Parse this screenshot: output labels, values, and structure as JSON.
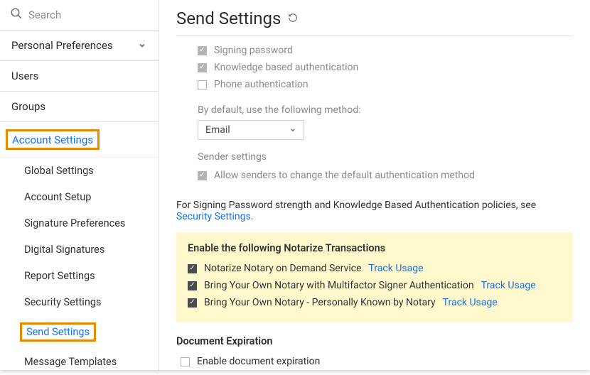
{
  "search": {
    "placeholder": "Search"
  },
  "sidebar": {
    "personal_prefs": "Personal Preferences",
    "users": "Users",
    "groups": "Groups",
    "account_settings": "Account Settings",
    "items": [
      {
        "label": "Global Settings"
      },
      {
        "label": "Account Setup"
      },
      {
        "label": "Signature Preferences"
      },
      {
        "label": "Digital Signatures"
      },
      {
        "label": "Report Settings"
      },
      {
        "label": "Security Settings"
      },
      {
        "label": "Send Settings"
      },
      {
        "label": "Message Templates"
      }
    ]
  },
  "page": {
    "title": "Send Settings",
    "auth_methods": {
      "signing_password": "Signing password",
      "kba": "Knowledge based authentication",
      "phone": "Phone authentication"
    },
    "default_method_label": "By default, use the following method:",
    "default_method_value": "Email",
    "sender_settings_label": "Sender settings",
    "allow_senders": "Allow senders to change the default authentication method",
    "policies_text_prefix": "For Signing Password strength and Knowledge Based Authentication policies, see ",
    "policies_link": "Security Settings",
    "notarize": {
      "title": "Enable the following Notarize Transactions",
      "items": [
        {
          "label": "Notarize Notary on Demand Service",
          "link": "Track Usage"
        },
        {
          "label": "Bring Your Own Notary with Multifactor Signer Authentication",
          "link": "Track Usage"
        },
        {
          "label": "Bring Your Own Notary - Personally Known by Notary",
          "link": "Track Usage"
        }
      ]
    },
    "doc_expiration": {
      "title": "Document Expiration",
      "enable": "Enable document expiration"
    }
  }
}
